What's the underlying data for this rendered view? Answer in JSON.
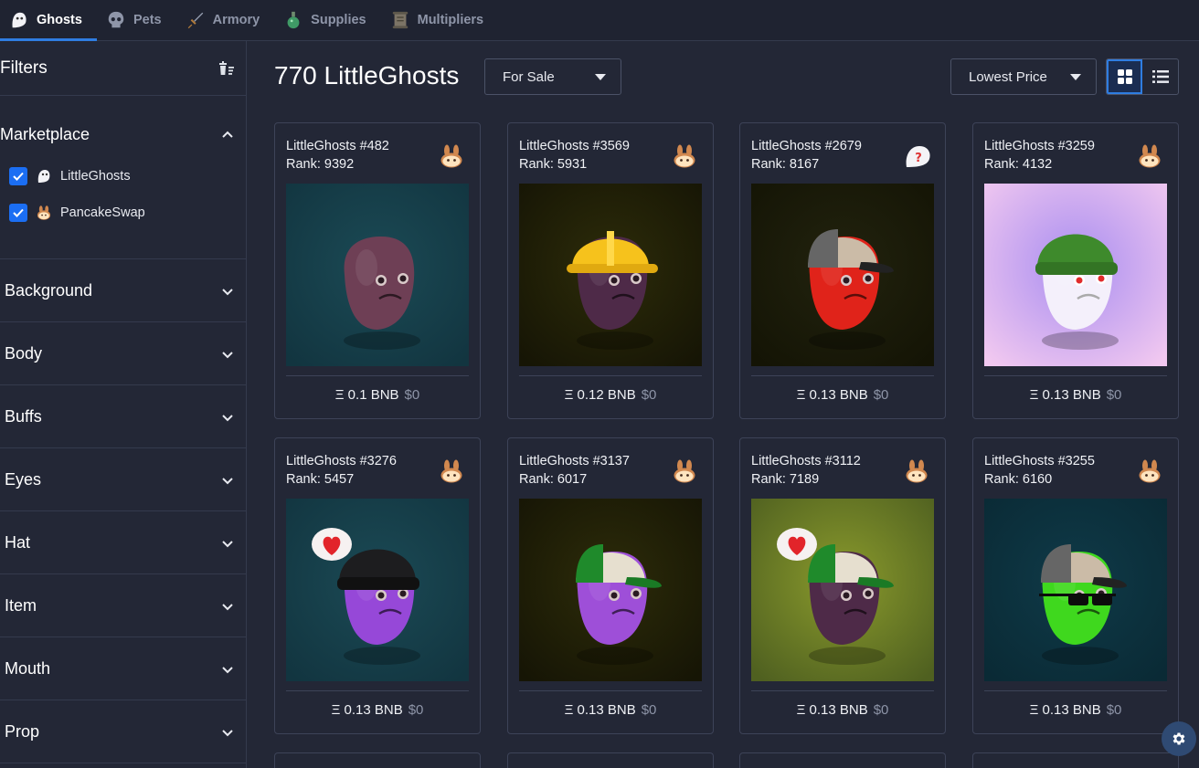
{
  "nav": {
    "tabs": [
      {
        "label": "Ghosts",
        "icon": "ghost-icon",
        "active": true
      },
      {
        "label": "Pets",
        "icon": "skull-icon",
        "active": false
      },
      {
        "label": "Armory",
        "icon": "sword-icon",
        "active": false
      },
      {
        "label": "Supplies",
        "icon": "potion-icon",
        "active": false
      },
      {
        "label": "Multipliers",
        "icon": "scroll-icon",
        "active": false
      }
    ]
  },
  "sidebar": {
    "title": "Filters",
    "clear_icon": "clear-filters-icon",
    "marketplace": {
      "title": "Marketplace",
      "options": [
        {
          "label": "LittleGhosts",
          "checked": true,
          "icon": "ghost-icon"
        },
        {
          "label": "PancakeSwap",
          "checked": true,
          "icon": "bunny-icon"
        }
      ]
    },
    "facets": [
      "Background",
      "Body",
      "Buffs",
      "Eyes",
      "Hat",
      "Item",
      "Mouth",
      "Prop"
    ]
  },
  "main": {
    "title": "770 LittleGhosts",
    "sale_filter": "For Sale",
    "sort": "Lowest Price",
    "view_mode": "grid"
  },
  "cards": [
    {
      "name": "LittleGhosts #482",
      "rank": "Rank: 9392",
      "price": "Ξ 0.1 BNB",
      "usd": "$0",
      "market": "bunny-icon",
      "bg": [
        "#1b4a55",
        "#123540"
      ],
      "skin": "#6e3f55",
      "hat": "none",
      "prop": "none"
    },
    {
      "name": "LittleGhosts #3569",
      "rank": "Rank: 5931",
      "price": "Ξ 0.12 BNB",
      "usd": "$0",
      "market": "bunny-icon",
      "bg": [
        "#2d2c09",
        "#161505"
      ],
      "skin": "#4e2a48",
      "hat": "hardhat",
      "prop": "none"
    },
    {
      "name": "LittleGhosts #2679",
      "rank": "Rank: 8167",
      "price": "Ξ 0.13 BNB",
      "usd": "$0",
      "market": "ghost-icon",
      "bg": [
        "#22230e",
        "#141405"
      ],
      "skin": "#e0231a",
      "hat": "cap-grey",
      "prop": "none"
    },
    {
      "name": "LittleGhosts #3259",
      "rank": "Rank: 4132",
      "price": "Ξ 0.13 BNB",
      "usd": "$0",
      "market": "bunny-icon",
      "bg": [
        "#a98ef0",
        "#f1c8f0"
      ],
      "skin": "#f4f0fb",
      "hat": "beanie-green",
      "prop": "none"
    },
    {
      "name": "LittleGhosts #3276",
      "rank": "Rank: 5457",
      "price": "Ξ 0.13 BNB",
      "usd": "$0",
      "market": "bunny-icon",
      "bg": [
        "#1b4a55",
        "#123540"
      ],
      "skin": "#9648d8",
      "hat": "beanie-black",
      "prop": "heart"
    },
    {
      "name": "LittleGhosts #3137",
      "rank": "Rank: 6017",
      "price": "Ξ 0.13 BNB",
      "usd": "$0",
      "market": "bunny-icon",
      "bg": [
        "#2d2c09",
        "#161505"
      ],
      "skin": "#9e4fd8",
      "hat": "cap-green",
      "prop": "none"
    },
    {
      "name": "LittleGhosts #3112",
      "rank": "Rank: 7189",
      "price": "Ξ 0.13 BNB",
      "usd": "$0",
      "market": "bunny-icon",
      "bg": [
        "#8a9a2c",
        "#4f6020"
      ],
      "skin": "#4e2a48",
      "hat": "cap-green",
      "prop": "heart"
    },
    {
      "name": "LittleGhosts #3255",
      "rank": "Rank: 6160",
      "price": "Ξ 0.13 BNB",
      "usd": "$0",
      "market": "bunny-icon",
      "bg": [
        "#0f3a48",
        "#0a2a35"
      ],
      "skin": "#3fd81e",
      "hat": "cap-grey",
      "prop": "sunglasses"
    }
  ],
  "settings_icon": "gear-icon"
}
